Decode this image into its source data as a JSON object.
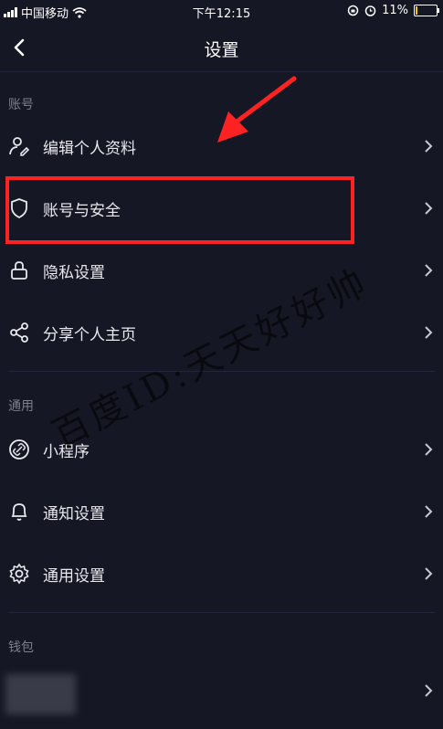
{
  "status_bar": {
    "carrier": "中国移动",
    "time": "下午12:15",
    "battery": "11%",
    "battery_level": 0.11
  },
  "header": {
    "title": "设置"
  },
  "sections": [
    {
      "label": "账号",
      "items": [
        {
          "label": "编辑个人资料",
          "icon": "user-edit-icon"
        },
        {
          "label": "账号与安全",
          "icon": "shield-icon"
        },
        {
          "label": "隐私设置",
          "icon": "lock-icon"
        },
        {
          "label": "分享个人主页",
          "icon": "share-icon"
        }
      ]
    },
    {
      "label": "通用",
      "items": [
        {
          "label": "小程序",
          "icon": "link-icon"
        },
        {
          "label": "通知设置",
          "icon": "bell-icon"
        },
        {
          "label": "通用设置",
          "icon": "gear-icon"
        }
      ]
    },
    {
      "label": "钱包",
      "items": [
        {
          "label": "",
          "icon": "wallet-icon"
        }
      ]
    }
  ],
  "watermark": "百度ID:天天好好帅",
  "colors": {
    "background": "#161724",
    "highlight": "#ff2222",
    "text": "#e8e8ee",
    "section_label": "#7d7f8e"
  }
}
